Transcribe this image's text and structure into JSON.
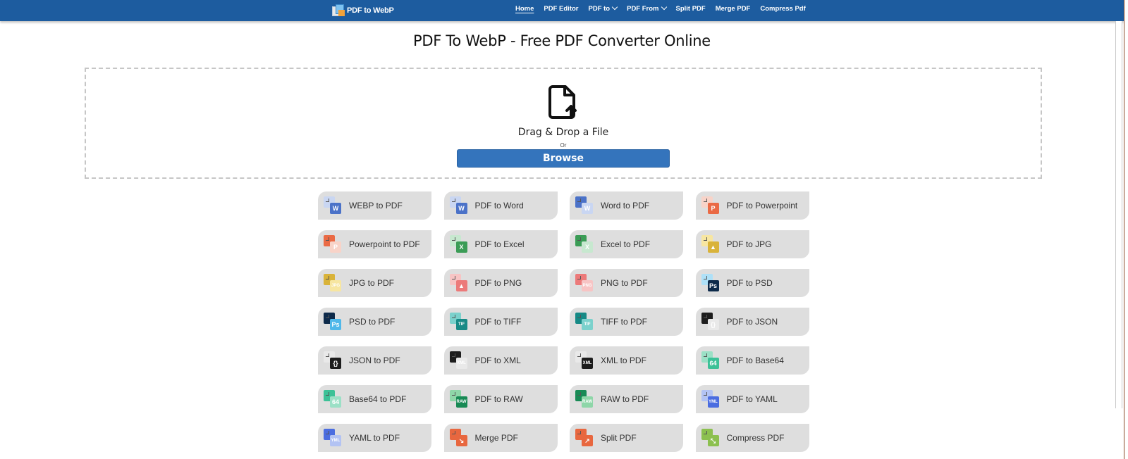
{
  "nav": {
    "logo_text": "PDF to WebP",
    "links": [
      {
        "label": "Home",
        "active": true,
        "dropdown": false
      },
      {
        "label": "PDF Editor",
        "active": false,
        "dropdown": false
      },
      {
        "label": "PDF to",
        "active": false,
        "dropdown": true
      },
      {
        "label": "PDF From",
        "active": false,
        "dropdown": true
      },
      {
        "label": "Split PDF",
        "active": false,
        "dropdown": false
      },
      {
        "label": "Merge PDF",
        "active": false,
        "dropdown": false
      },
      {
        "label": "Compress Pdf",
        "active": false,
        "dropdown": false
      }
    ]
  },
  "main": {
    "title": "PDF To WebP - Free PDF Converter Online",
    "drop_text": "Drag & Drop a File",
    "or_text": "Or",
    "browse_label": "Browse"
  },
  "colors": {
    "nav_bg": "#1d5c9f",
    "browse_bg": "#3474bc",
    "tile_bg": "#dedede"
  },
  "tools": [
    {
      "label": "WEBP to PDF",
      "icon": "webp-to-pdf-icon",
      "back": "#c9d6f2",
      "front": "#4b72c8",
      "glyph": "W"
    },
    {
      "label": "PDF to Word",
      "icon": "pdf-to-word-icon",
      "back": "#c9d6f2",
      "front": "#4b72c8",
      "glyph": "W"
    },
    {
      "label": "Word to PDF",
      "icon": "word-to-pdf-icon",
      "back": "#4b72c8",
      "front": "#c9d6f2",
      "glyph": "W"
    },
    {
      "label": "PDF to Powerpoint",
      "icon": "pdf-to-powerpoint-icon",
      "back": "#f8d3c8",
      "front": "#ea6a45",
      "glyph": "P"
    },
    {
      "label": "Powerpoint to PDF",
      "icon": "powerpoint-to-pdf-icon",
      "back": "#ea6a45",
      "front": "#f8d3c8",
      "glyph": "P"
    },
    {
      "label": "PDF to Excel",
      "icon": "pdf-to-excel-icon",
      "back": "#c7e8cf",
      "front": "#3b9c56",
      "glyph": "X"
    },
    {
      "label": "Excel to PDF",
      "icon": "excel-to-pdf-icon",
      "back": "#3b9c56",
      "front": "#c7e8cf",
      "glyph": "X"
    },
    {
      "label": "PDF to JPG",
      "icon": "pdf-to-jpg-icon",
      "back": "#f7e6a1",
      "front": "#d9b33a",
      "glyph": "▲"
    },
    {
      "label": "JPG to PDF",
      "icon": "jpg-to-pdf-icon",
      "back": "#d9b33a",
      "front": "#f7e6a1",
      "glyph": "JPG"
    },
    {
      "label": "PDF to PNG",
      "icon": "pdf-to-png-icon",
      "back": "#f7c4c4",
      "front": "#ec7a7a",
      "glyph": "▲"
    },
    {
      "label": "PNG to PDF",
      "icon": "png-to-pdf-icon",
      "back": "#ec7a7a",
      "front": "#f7c4c4",
      "glyph": "PNG"
    },
    {
      "label": "PDF to PSD",
      "icon": "pdf-to-psd-icon",
      "back": "#aee0f7",
      "front": "#0d2a4a",
      "glyph": "Ps"
    },
    {
      "label": "PSD to PDF",
      "icon": "psd-to-pdf-icon",
      "back": "#0d2a4a",
      "front": "#4fb8ea",
      "glyph": "Ps"
    },
    {
      "label": "PDF to TIFF",
      "icon": "pdf-to-tiff-icon",
      "back": "#7bd1cc",
      "front": "#178a86",
      "glyph": "TIF"
    },
    {
      "label": "TIFF to PDF",
      "icon": "tiff-to-pdf-icon",
      "back": "#178a86",
      "front": "#7bd1cc",
      "glyph": "TIF"
    },
    {
      "label": "PDF to JSON",
      "icon": "pdf-to-json-icon",
      "back": "#1d1d1d",
      "front": "#e9e9e9",
      "glyph": "{}"
    },
    {
      "label": "JSON to PDF",
      "icon": "json-to-pdf-icon",
      "back": "#e9e9e9",
      "front": "#1d1d1d",
      "glyph": "{}"
    },
    {
      "label": "PDF to XML",
      "icon": "pdf-to-xml-icon",
      "back": "#1d1d1d",
      "front": "#e9e9e9",
      "glyph": "XML"
    },
    {
      "label": "XML to PDF",
      "icon": "xml-to-pdf-icon",
      "back": "#e9e9e9",
      "front": "#1d1d1d",
      "glyph": "XML"
    },
    {
      "label": "PDF to Base64",
      "icon": "pdf-to-base64-icon",
      "back": "#9be0c6",
      "front": "#3cc197",
      "glyph": "64"
    },
    {
      "label": "Base64 to PDF",
      "icon": "base64-to-pdf-icon",
      "back": "#3cc197",
      "front": "#9be0c6",
      "glyph": "64"
    },
    {
      "label": "PDF to RAW",
      "icon": "pdf-to-raw-icon",
      "back": "#8ed6a8",
      "front": "#188a55",
      "glyph": "RAW"
    },
    {
      "label": "RAW to PDF",
      "icon": "raw-to-pdf-icon",
      "back": "#188a55",
      "front": "#8ed6a8",
      "glyph": "RAW"
    },
    {
      "label": "PDF to YAML",
      "icon": "pdf-to-yaml-icon",
      "back": "#b3c3f3",
      "front": "#4b6de0",
      "glyph": "YML"
    },
    {
      "label": "YAML to PDF",
      "icon": "yaml-to-pdf-icon",
      "back": "#4b6de0",
      "front": "#b3c3f3",
      "glyph": "YML"
    },
    {
      "label": "Merge PDF",
      "icon": "merge-pdf-icon",
      "back": "#e8673f",
      "front": "#e8673f",
      "glyph": "↘"
    },
    {
      "label": "Split PDF",
      "icon": "split-pdf-icon",
      "back": "#e8673f",
      "front": "#e8673f",
      "glyph": "↗"
    },
    {
      "label": "Compress PDF",
      "icon": "compress-pdf-icon",
      "back": "#8cc04f",
      "front": "#8cc04f",
      "glyph": "⤡"
    }
  ]
}
